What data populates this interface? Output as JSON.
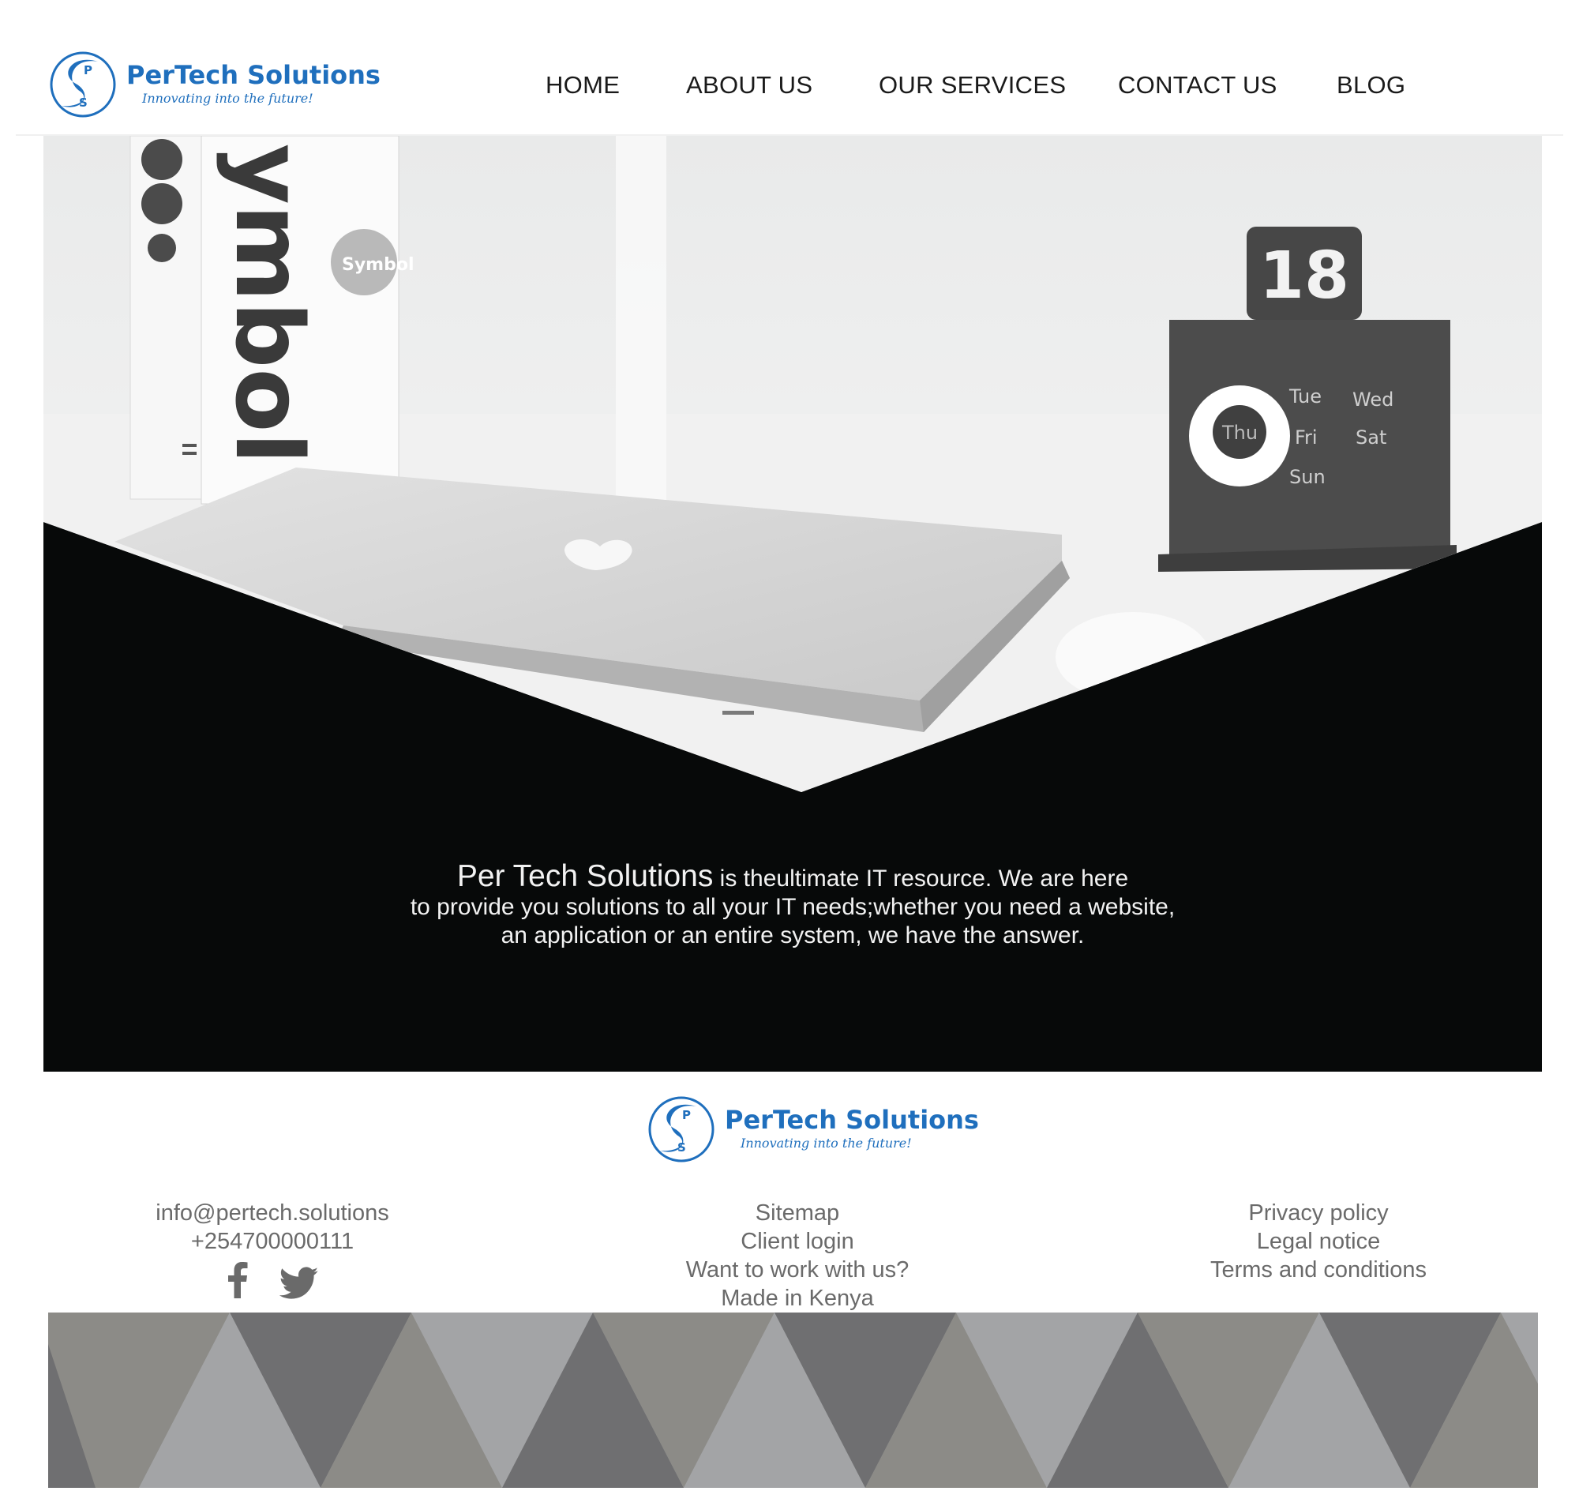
{
  "brand": {
    "name": "PerTech Solutions",
    "tagline": "Innovating into the future!",
    "logo_letters": [
      "P",
      "S"
    ]
  },
  "nav": {
    "items": [
      {
        "label": "HOME"
      },
      {
        "label": "ABOUT US"
      },
      {
        "label": "OUR SERVICES"
      },
      {
        "label": "CONTACT US"
      },
      {
        "label": "BLOG"
      }
    ]
  },
  "hero": {
    "lead": "Per Tech Solutions",
    "line1_rest": " is theultimate IT resource. We are here",
    "line2": "to provide you solutions to all your  IT needs;whether you need a website,",
    "line3": "an application or an entire system, we have the answer.",
    "book_spine_text": "ymbol",
    "book_sticker_text": "Symbol",
    "calendar_number": "18",
    "calendar_days": [
      "Thu",
      "Tue",
      "Wed",
      "Fri",
      "Sat",
      "Sun"
    ]
  },
  "footer": {
    "contact": {
      "email": "info@pertech.solutions",
      "phone": "+254700000111"
    },
    "links_middle": [
      "Sitemap",
      "Client login",
      "Want to work with us?",
      "Made in Kenya"
    ],
    "links_right": [
      "Privacy policy",
      "Legal notice",
      "Terms and conditions"
    ],
    "social": [
      "facebook-icon",
      "twitter-icon"
    ]
  },
  "colors": {
    "brand_blue": "#1f6fbd",
    "hero_black": "#070909",
    "footer_text": "#6a6a6a",
    "pattern": [
      "#8c8b87",
      "#6f6f71",
      "#a3a4a6",
      "#d0d0d0"
    ]
  }
}
